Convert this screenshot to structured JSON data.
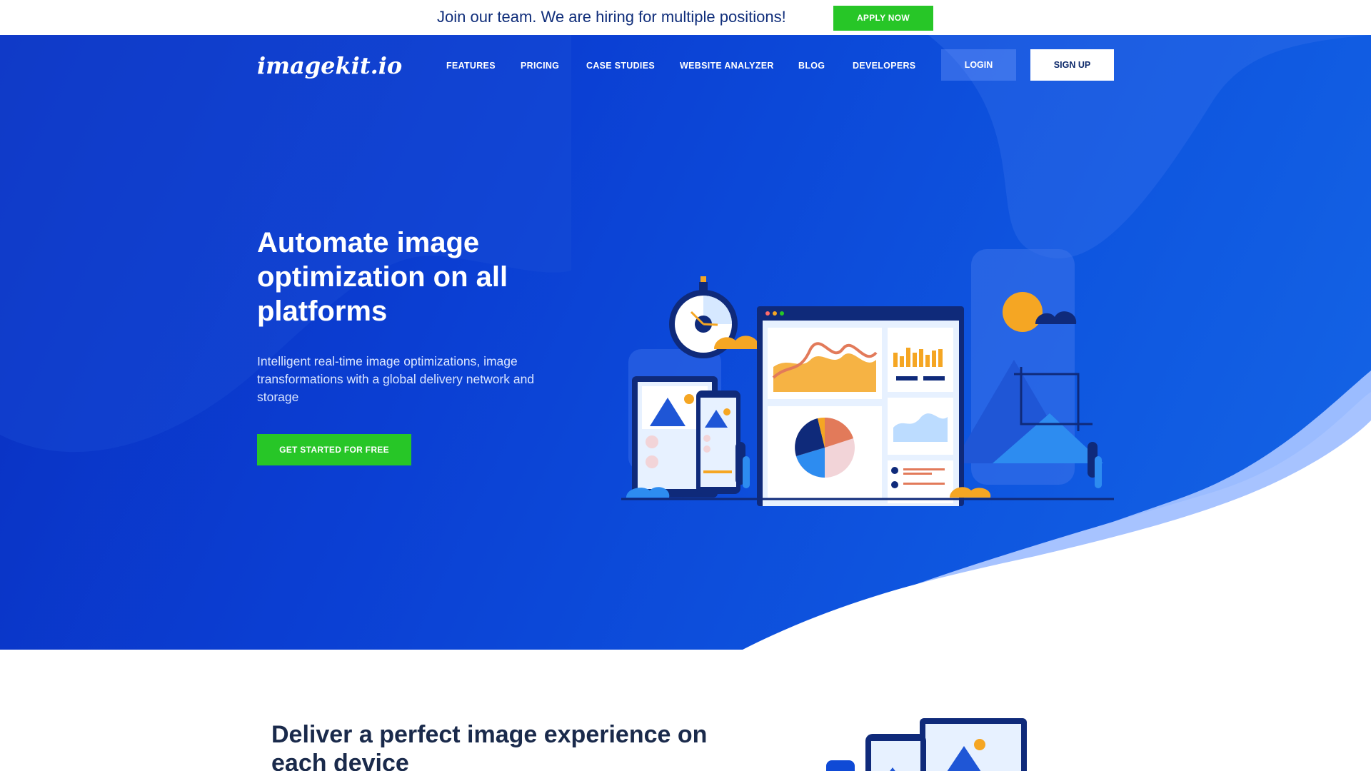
{
  "announcement": {
    "text": "Join our team. We are hiring for multiple positions!",
    "button_label": "APPLY NOW"
  },
  "header": {
    "logo_text": "imagekit.io",
    "nav": [
      "FEATURES",
      "PRICING",
      "CASE STUDIES",
      "WEBSITE ANALYZER",
      "BLOG",
      "DEVELOPERS"
    ],
    "login_label": "LOGIN",
    "signup_label": "SIGN UP"
  },
  "hero": {
    "title": "Automate image optimization on all platforms",
    "subtitle": "Intelligent real-time image optimizations, image transformations with a global delivery network and storage",
    "cta_label": "GET STARTED FOR FREE"
  },
  "section": {
    "title": "Deliver a perfect image experience on each device"
  },
  "colors": {
    "brand_blue": "#0b3fd3",
    "cta_green": "#27c627",
    "accent_orange": "#f5a623"
  }
}
